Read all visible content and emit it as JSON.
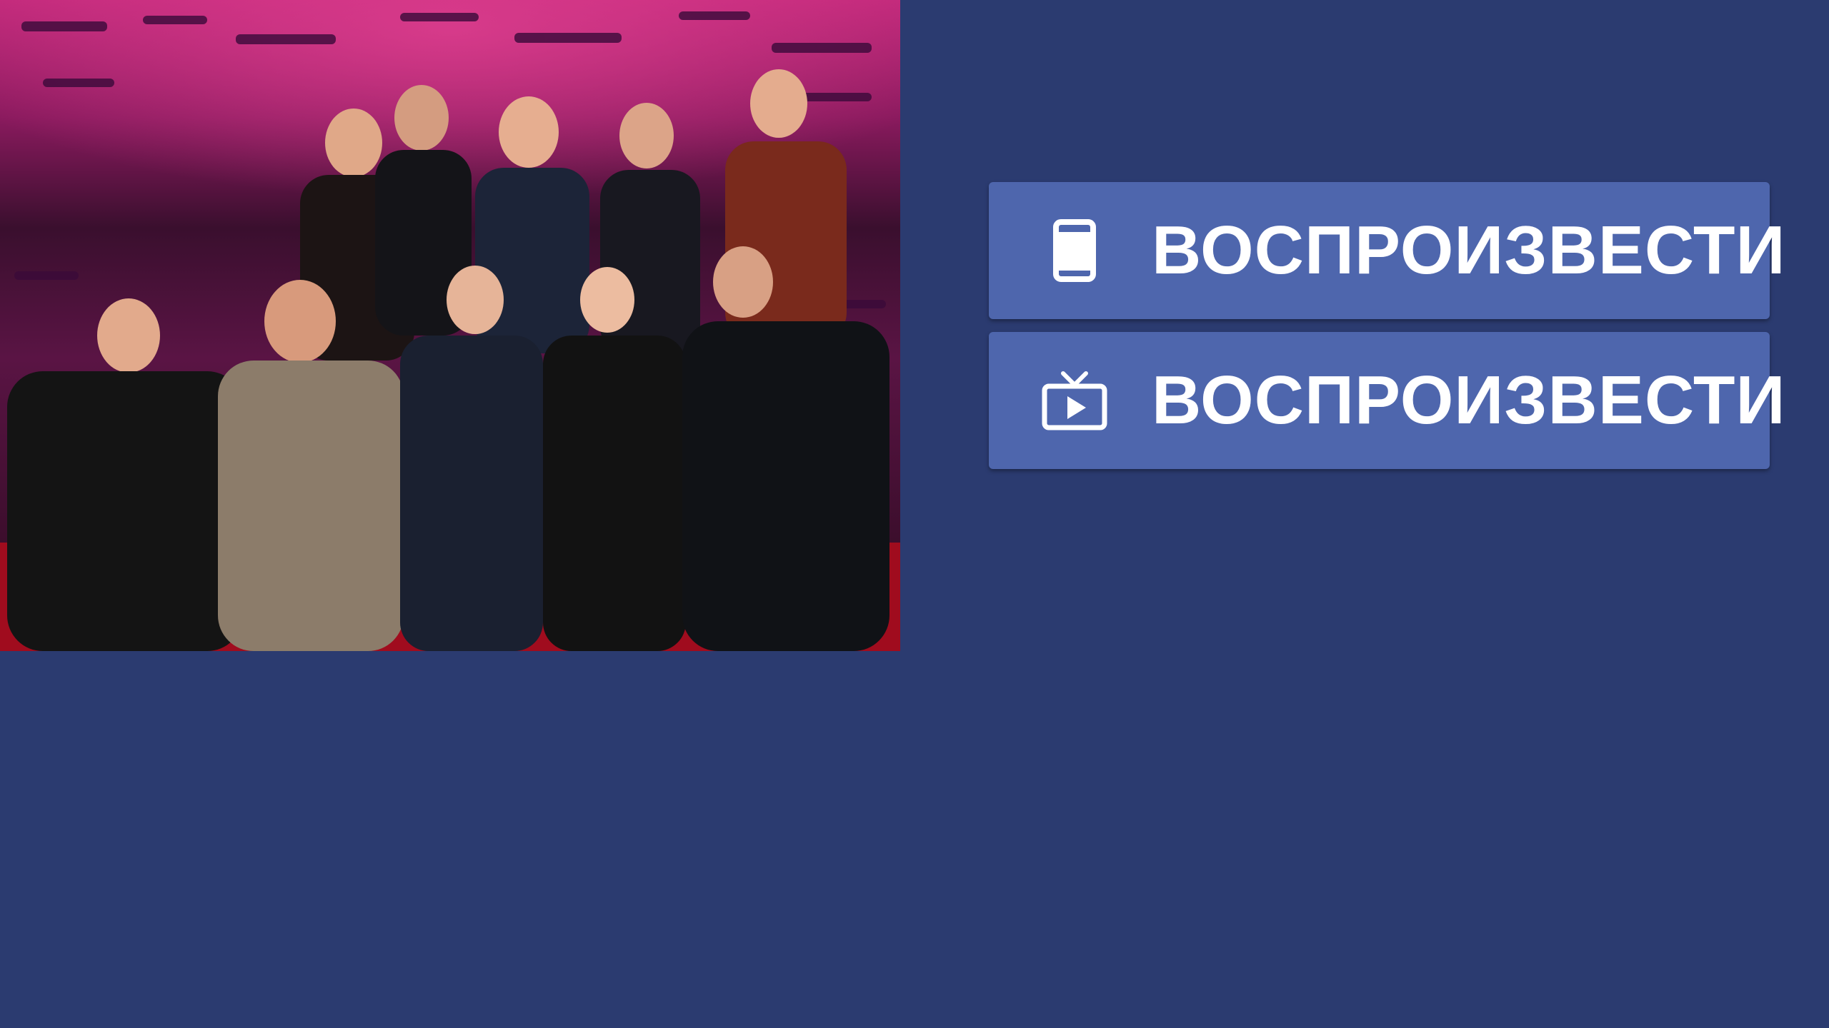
{
  "poster": {
    "alt": "TV show guests group photo on pink-purple studio set",
    "colors": {
      "stage_pink": "#b8206e",
      "stage_purple": "#6a1a6e",
      "sofa_red": "#b01020"
    }
  },
  "actions": [
    {
      "label": "ВОСПРОИЗВЕСТИ",
      "icon": "phone-icon"
    },
    {
      "label": "ВОСПРОИЗВЕСТИ",
      "icon": "tv-play-icon"
    }
  ],
  "theme": {
    "background": "#2b3b70",
    "button": "#4e66ad",
    "text": "#ffffff"
  }
}
